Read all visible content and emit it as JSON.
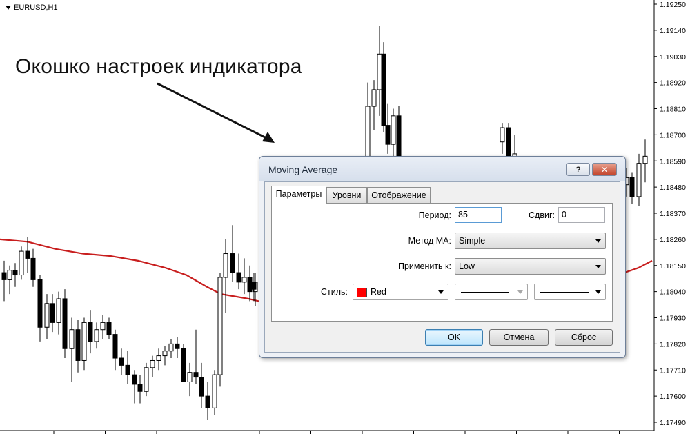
{
  "chart": {
    "symbol": "EURUSD,H1",
    "annotation": "Окошко настроек индикатора",
    "price_labels": [
      "1.19250",
      "1.19140",
      "1.19030",
      "1.18920",
      "1.18810",
      "1.18700",
      "1.18590",
      "1.18480",
      "1.18370",
      "1.18260",
      "1.18150",
      "1.18040",
      "1.17930",
      "1.17820",
      "1.17710",
      "1.17600",
      "1.17490"
    ],
    "ma_color": "#c81e1e"
  },
  "chart_data": {
    "type": "candlestick",
    "ylim": [
      1.1745,
      1.193
    ],
    "candles": [
      {
        "o": 1.1812,
        "h": 1.1817,
        "l": 1.18,
        "c": 1.1809
      },
      {
        "o": 1.1809,
        "h": 1.1815,
        "l": 1.1803,
        "c": 1.1813
      },
      {
        "o": 1.1813,
        "h": 1.1816,
        "l": 1.1806,
        "c": 1.1811
      },
      {
        "o": 1.1811,
        "h": 1.1823,
        "l": 1.1809,
        "c": 1.1821
      },
      {
        "o": 1.1821,
        "h": 1.1827,
        "l": 1.1812,
        "c": 1.1818
      },
      {
        "o": 1.1818,
        "h": 1.1822,
        "l": 1.1806,
        "c": 1.1809
      },
      {
        "o": 1.1809,
        "h": 1.1811,
        "l": 1.1783,
        "c": 1.1789
      },
      {
        "o": 1.1789,
        "h": 1.1803,
        "l": 1.1784,
        "c": 1.1799
      },
      {
        "o": 1.1799,
        "h": 1.1803,
        "l": 1.1787,
        "c": 1.1791
      },
      {
        "o": 1.1791,
        "h": 1.1804,
        "l": 1.1786,
        "c": 1.1801
      },
      {
        "o": 1.1801,
        "h": 1.1805,
        "l": 1.1776,
        "c": 1.178
      },
      {
        "o": 1.178,
        "h": 1.1793,
        "l": 1.1766,
        "c": 1.1788
      },
      {
        "o": 1.1788,
        "h": 1.1792,
        "l": 1.177,
        "c": 1.1775
      },
      {
        "o": 1.1775,
        "h": 1.1793,
        "l": 1.1771,
        "c": 1.1791
      },
      {
        "o": 1.1791,
        "h": 1.1796,
        "l": 1.1778,
        "c": 1.1783
      },
      {
        "o": 1.1783,
        "h": 1.1791,
        "l": 1.178,
        "c": 1.1788
      },
      {
        "o": 1.1788,
        "h": 1.1794,
        "l": 1.1784,
        "c": 1.1791
      },
      {
        "o": 1.1791,
        "h": 1.1793,
        "l": 1.1784,
        "c": 1.1786
      },
      {
        "o": 1.1786,
        "h": 1.1788,
        "l": 1.1771,
        "c": 1.1776
      },
      {
        "o": 1.1776,
        "h": 1.178,
        "l": 1.1769,
        "c": 1.1773
      },
      {
        "o": 1.1773,
        "h": 1.1779,
        "l": 1.1765,
        "c": 1.1769
      },
      {
        "o": 1.1769,
        "h": 1.1771,
        "l": 1.1757,
        "c": 1.1765
      },
      {
        "o": 1.1765,
        "h": 1.1769,
        "l": 1.1757,
        "c": 1.1762
      },
      {
        "o": 1.1762,
        "h": 1.1774,
        "l": 1.176,
        "c": 1.1772
      },
      {
        "o": 1.1772,
        "h": 1.1777,
        "l": 1.1768,
        "c": 1.1775
      },
      {
        "o": 1.1775,
        "h": 1.178,
        "l": 1.1771,
        "c": 1.1777
      },
      {
        "o": 1.1777,
        "h": 1.1781,
        "l": 1.1773,
        "c": 1.1779
      },
      {
        "o": 1.1779,
        "h": 1.1784,
        "l": 1.1776,
        "c": 1.1782
      },
      {
        "o": 1.1782,
        "h": 1.1785,
        "l": 1.1776,
        "c": 1.178
      },
      {
        "o": 1.178,
        "h": 1.1782,
        "l": 1.1768,
        "c": 1.1766
      },
      {
        "o": 1.1766,
        "h": 1.1774,
        "l": 1.176,
        "c": 1.177
      },
      {
        "o": 1.177,
        "h": 1.1788,
        "l": 1.1765,
        "c": 1.1768
      },
      {
        "o": 1.1768,
        "h": 1.1774,
        "l": 1.1755,
        "c": 1.176
      },
      {
        "o": 1.176,
        "h": 1.1766,
        "l": 1.175,
        "c": 1.1755
      },
      {
        "o": 1.1755,
        "h": 1.1771,
        "l": 1.1752,
        "c": 1.1769
      },
      {
        "o": 1.1769,
        "h": 1.1812,
        "l": 1.1764,
        "c": 1.181
      },
      {
        "o": 1.181,
        "h": 1.1826,
        "l": 1.1795,
        "c": 1.182
      },
      {
        "o": 1.182,
        "h": 1.1832,
        "l": 1.1808,
        "c": 1.1812
      },
      {
        "o": 1.1812,
        "h": 1.182,
        "l": 1.1805,
        "c": 1.1808
      },
      {
        "o": 1.1808,
        "h": 1.1818,
        "l": 1.1803,
        "c": 1.181
      },
      {
        "o": 1.181,
        "h": 1.1815,
        "l": 1.18,
        "c": 1.1804
      },
      {
        "o": 1.1804,
        "h": 1.1812,
        "l": 1.1798,
        "c": 1.1808
      },
      {
        "o": 1.1808,
        "h": 1.1812,
        "l": 1.18,
        "c": 1.1805
      },
      {
        "o": 1.1852,
        "h": 1.1892,
        "l": 1.1848,
        "c": 1.1882
      },
      {
        "o": 1.1882,
        "h": 1.1893,
        "l": 1.1872,
        "c": 1.1889
      },
      {
        "o": 1.1889,
        "h": 1.1916,
        "l": 1.1878,
        "c": 1.1904
      },
      {
        "o": 1.1904,
        "h": 1.1909,
        "l": 1.1871,
        "c": 1.1874
      },
      {
        "o": 1.1874,
        "h": 1.1883,
        "l": 1.1862,
        "c": 1.1866
      },
      {
        "o": 1.1866,
        "h": 1.1881,
        "l": 1.1857,
        "c": 1.1878
      },
      {
        "o": 1.1878,
        "h": 1.1882,
        "l": 1.1852,
        "c": 1.1856
      },
      {
        "o": 1.1867,
        "h": 1.1875,
        "l": 1.1862,
        "c": 1.1873
      },
      {
        "o": 1.1873,
        "h": 1.1875,
        "l": 1.1857,
        "c": 1.186
      },
      {
        "o": 1.186,
        "h": 1.187,
        "l": 1.1855,
        "c": 1.1862
      },
      {
        "o": 1.1849,
        "h": 1.1856,
        "l": 1.1844,
        "c": 1.1852
      },
      {
        "o": 1.1852,
        "h": 1.1854,
        "l": 1.1841,
        "c": 1.1844
      },
      {
        "o": 1.1844,
        "h": 1.1862,
        "l": 1.184,
        "c": 1.1858
      },
      {
        "o": 1.1858,
        "h": 1.1868,
        "l": 1.185,
        "c": 1.1861
      }
    ],
    "candle_x": [
      6,
      14,
      22,
      31,
      40,
      48,
      58,
      68,
      76,
      85,
      94,
      104,
      113,
      122,
      131,
      140,
      149,
      158,
      167,
      176,
      185,
      195,
      203,
      212,
      221,
      230,
      239,
      248,
      257,
      266,
      275,
      284,
      292,
      301,
      311,
      319,
      327,
      337,
      346,
      354,
      362,
      370,
      368,
      533,
      542,
      550,
      556,
      562,
      570,
      578,
      728,
      737,
      746,
      908,
      916,
      926,
      935,
      944
    ],
    "ma": {
      "name": "Moving Average",
      "x": [
        0,
        40,
        80,
        120,
        160,
        200,
        240,
        270,
        300,
        320,
        340,
        360,
        375,
        905,
        925,
        945
      ],
      "y": [
        1.1826,
        1.1825,
        1.1822,
        1.182,
        1.1819,
        1.1817,
        1.1814,
        1.1811,
        1.1806,
        1.1803,
        1.1802,
        1.1801,
        1.18,
        1.1812,
        1.1814,
        1.1817
      ]
    }
  },
  "dialog": {
    "title": "Moving Average",
    "help_glyph": "?",
    "close_glyph": "✕",
    "tabs": [
      {
        "label": "Параметры",
        "active": true
      },
      {
        "label": "Уровни",
        "active": false
      },
      {
        "label": "Отображение",
        "active": false
      }
    ],
    "period_label": "Период:",
    "period_value": "85",
    "shift_label": "Сдвиг:",
    "shift_value": "0",
    "method_label": "Метод МА:",
    "method_value": "Simple",
    "apply_label": "Применить к:",
    "apply_value": "Low",
    "style_label": "Стиль:",
    "color_value": "Red",
    "color_hex": "#ff0000",
    "ok_label": "OK",
    "cancel_label": "Отмена",
    "reset_label": "Сброс"
  }
}
